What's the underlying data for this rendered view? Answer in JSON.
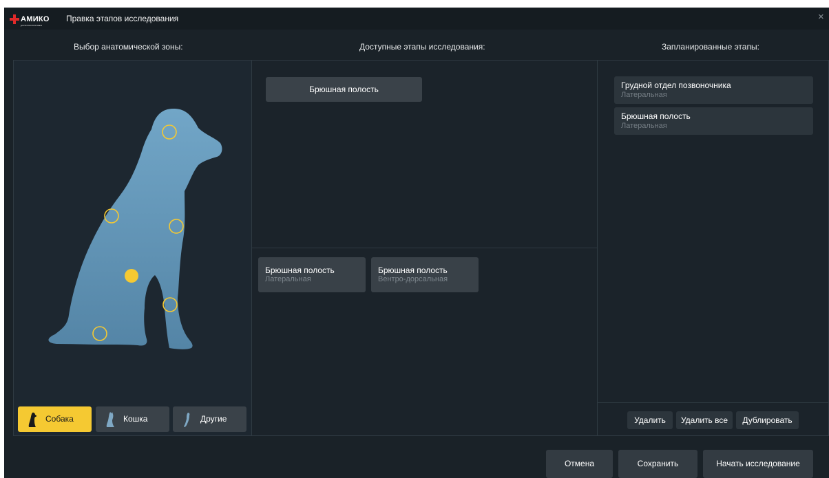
{
  "window": {
    "title": "Правка этапов исследования",
    "logo_text": "АМИКО",
    "logo_subtext": "рентгенотехника",
    "close_glyph": "×"
  },
  "columns": {
    "left_header": "Выбор анатомической зоны:",
    "mid_header": "Доступные этапы исследования:",
    "right_header": "Запланированные этапы:"
  },
  "anatomy": {
    "zones": [
      {
        "name": "head",
        "selected": false
      },
      {
        "name": "neck-back",
        "selected": false
      },
      {
        "name": "chest",
        "selected": false
      },
      {
        "name": "abdomen",
        "selected": true
      },
      {
        "name": "front-leg",
        "selected": false
      },
      {
        "name": "hind-paw",
        "selected": false
      }
    ],
    "accent_color": "#f5c932",
    "animals": [
      {
        "label": "Собака",
        "icon": "dog-icon",
        "active": true
      },
      {
        "label": "Кошка",
        "icon": "cat-icon",
        "active": false
      },
      {
        "label": "Другие",
        "icon": "bird-icon",
        "active": false
      }
    ]
  },
  "available": {
    "zone_label": "Брюшная полость",
    "stages": [
      {
        "title": "Брюшная полость",
        "projection": "Латеральная"
      },
      {
        "title": "Брюшная полость",
        "projection": "Вентро-дорсальная"
      }
    ]
  },
  "planned": {
    "items": [
      {
        "title": "Грудной отдел позвоночника",
        "projection": "Латеральная"
      },
      {
        "title": "Брюшная полость",
        "projection": "Латеральная"
      }
    ],
    "delete_label": "Удалить",
    "delete_all_label": "Удалить все",
    "duplicate_label": "Дублировать"
  },
  "footer": {
    "cancel_label": "Отмена",
    "save_label": "Сохранить",
    "start_label": "Начать исследование"
  }
}
